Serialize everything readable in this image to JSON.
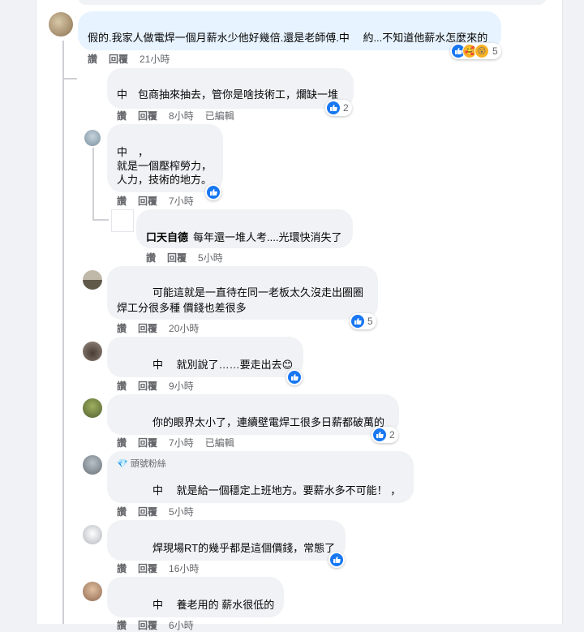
{
  "actions": {
    "like": "讚",
    "reply": "回覆",
    "edited": "已編輯"
  },
  "comments": [
    {
      "text": [
        "假的.我家人做電焊一個月薪水少他好幾倍.還是老師傅.中　 約...不知道他薪水怎麼來的"
      ],
      "time": "21小時",
      "reactions": "5"
    },
    {
      "text": [
        "包商抽來抽去，管你是啥技術工，爛缺一堆"
      ],
      "prefix": "中",
      "time": "8小時",
      "edited": true,
      "reactions": "2"
    },
    {
      "text": [
        "中　，",
        "就是一個壓榨勞力，",
        "人力，技術的地方。"
      ],
      "time": "7小時",
      "reactions": ""
    },
    {
      "author": "口天自德",
      "text": [
        "每年還一堆人考....光環快消失了"
      ],
      "time": "5小時"
    },
    {
      "text": [
        "可能這就是一直待在同一老板太久沒走出圈圈",
        "焊工分很多種 價錢也差很多"
      ],
      "time": "20小時",
      "reactions": "5"
    },
    {
      "text": [
        "中　 就別說了……要走出去😊"
      ],
      "time": "9小時",
      "reactions": ""
    },
    {
      "text": [
        "你的眼界太小了，連續壁電焊工很多日薪都破萬的"
      ],
      "time": "7小時",
      "edited": true,
      "reactions": "2"
    },
    {
      "badge": "頭號粉絲",
      "text": [
        "中　 就是給一個穩定上班地方。要薪水多不可能！ ，"
      ],
      "time": "5小時"
    },
    {
      "text": [
        "焊現場RT的幾乎都是這個價錢，常態了"
      ],
      "time": "16小時",
      "reactions": ""
    },
    {
      "text": [
        "中　 養老用的 薪水很低的"
      ],
      "time": "6小時"
    }
  ],
  "colors": {
    "like_blue": "#1877f2",
    "bubble": "#f0f2f5",
    "highlight_bubble": "#e7f3ff"
  }
}
